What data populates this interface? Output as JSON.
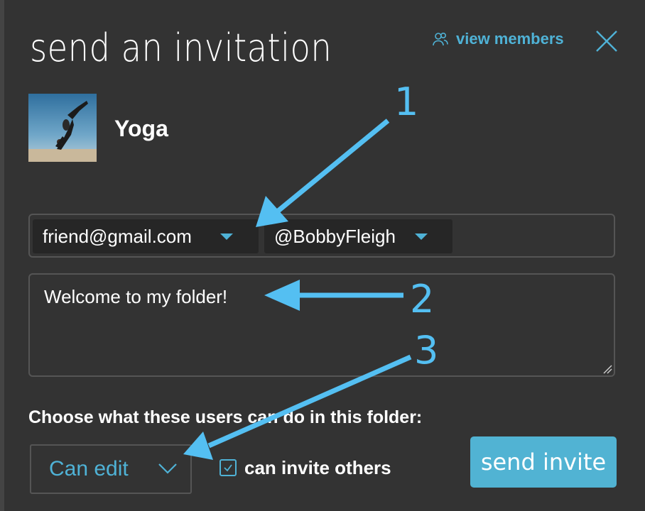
{
  "modal": {
    "title": "send an invitation",
    "view_members_label": "view members"
  },
  "folder": {
    "name": "Yoga"
  },
  "recipients": [
    {
      "label": "friend@gmail.com"
    },
    {
      "label": "@BobbyFleigh"
    }
  ],
  "message": {
    "value": "Welcome to my folder!"
  },
  "permissions": {
    "prompt": "Choose what these users can do in this folder:",
    "selected": "Can edit",
    "can_invite_label": "can invite others",
    "can_invite_checked": true
  },
  "send_button_label": "send invite",
  "annotations": {
    "n1": "1",
    "n2": "2",
    "n3": "3"
  },
  "colors": {
    "accent": "#4fb2d6",
    "button": "#51b3d3",
    "background": "#333333",
    "annotation": "#54bff2"
  }
}
